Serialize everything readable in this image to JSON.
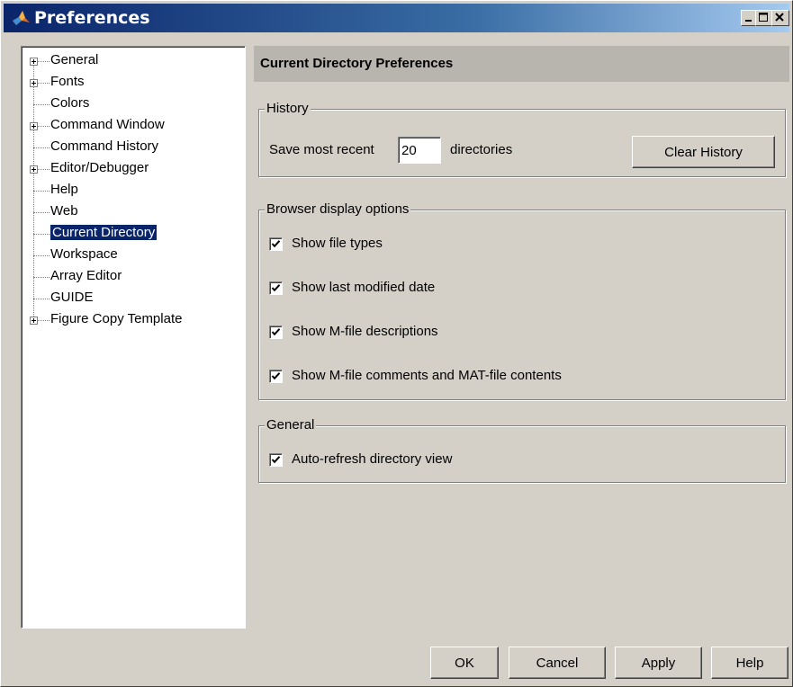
{
  "window": {
    "title": "Preferences",
    "controls": [
      "minimize",
      "maximize",
      "close"
    ]
  },
  "tree": [
    {
      "label": "General",
      "expandable": true
    },
    {
      "label": "Fonts",
      "expandable": true
    },
    {
      "label": "Colors",
      "expandable": false
    },
    {
      "label": "Command Window",
      "expandable": true
    },
    {
      "label": "Command History",
      "expandable": false
    },
    {
      "label": "Editor/Debugger",
      "expandable": true
    },
    {
      "label": "Help",
      "expandable": false
    },
    {
      "label": "Web",
      "expandable": false
    },
    {
      "label": "Current Directory",
      "expandable": false,
      "selected": true
    },
    {
      "label": "Workspace",
      "expandable": false
    },
    {
      "label": "Array Editor",
      "expandable": false
    },
    {
      "label": "GUIDE",
      "expandable": false
    },
    {
      "label": "Figure Copy Template",
      "expandable": true
    }
  ],
  "panel": {
    "title": "Current Directory Preferences",
    "history": {
      "legend": "History",
      "save_label": "Save most recent",
      "count": "20",
      "suffix": "directories",
      "clear_button": "Clear History"
    },
    "browser": {
      "legend": "Browser display options",
      "options": [
        {
          "label": "Show file types",
          "checked": true
        },
        {
          "label": "Show last modified date",
          "checked": true
        },
        {
          "label": "Show M-file descriptions",
          "checked": true
        },
        {
          "label": "Show M-file comments and MAT-file contents",
          "checked": true
        }
      ]
    },
    "general": {
      "legend": "General",
      "options": [
        {
          "label": "Auto-refresh directory view",
          "checked": true
        }
      ]
    }
  },
  "buttons": {
    "ok": "OK",
    "cancel": "Cancel",
    "apply": "Apply",
    "help": "Help"
  },
  "colors": {
    "title_start": "#0a246a",
    "title_end": "#a6caf0",
    "selection": "#0a246a",
    "face": "#d4d0c8"
  }
}
